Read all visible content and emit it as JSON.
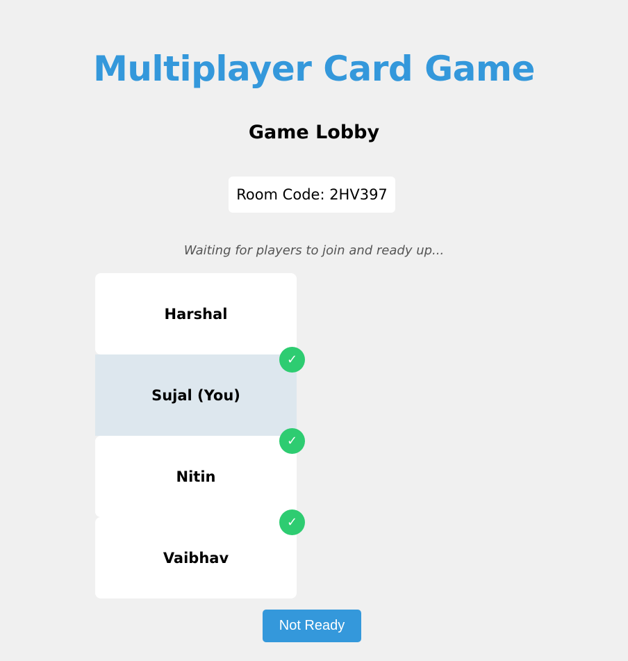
{
  "header": {
    "title": "Multiplayer Card Game",
    "subtitle": "Game Lobby"
  },
  "room": {
    "code_text": "Room Code: 2HV397"
  },
  "status_text": "Waiting for players to join and ready up...",
  "players": [
    {
      "name": "Harshal",
      "is_you": false,
      "ready": true,
      "ready_glyph": "✓"
    },
    {
      "name": "Sujal (You)",
      "is_you": true,
      "ready": true,
      "ready_glyph": "✓"
    },
    {
      "name": "Nitin",
      "is_you": false,
      "ready": true,
      "ready_glyph": "✓"
    },
    {
      "name": "Vaibhav",
      "is_you": false,
      "ready": false,
      "ready_glyph": ""
    }
  ],
  "actions": {
    "ready_button_label": "Not Ready"
  },
  "colors": {
    "accent": "#3498db",
    "ready_badge": "#2ecc71",
    "background": "#f0f0f0",
    "current_player_highlight": "#dde7ee",
    "card": "#ffffff"
  }
}
